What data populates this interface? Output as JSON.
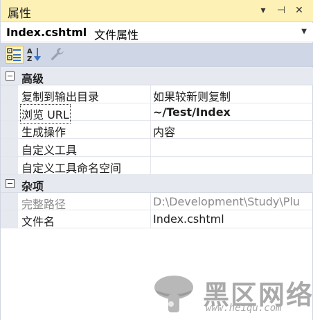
{
  "window": {
    "title": "属性",
    "dropdown_glyph": "▾",
    "pin_glyph": "⊣",
    "close_glyph": "✕"
  },
  "selector": {
    "object_name": "Index.cshtml",
    "object_type": "文件属性",
    "dropdown_glyph": "▼"
  },
  "toolbar": {
    "buttons": [
      {
        "icon": "categorized-icon",
        "active": true
      },
      {
        "icon": "alphabetical-sort-icon",
        "active": false
      },
      {
        "icon": "wrench-icon",
        "active": false
      }
    ]
  },
  "categories": [
    {
      "label": "高级",
      "properties": [
        {
          "name": "复制到输出目录",
          "value": "如果较新则复制"
        },
        {
          "name": "浏览 URL",
          "value": "~/Test/Index"
        },
        {
          "name": "生成操作",
          "value": "内容"
        },
        {
          "name": "自定义工具",
          "value": ""
        },
        {
          "name": "自定义工具命名空间",
          "value": ""
        }
      ]
    },
    {
      "label": "杂项",
      "properties": [
        {
          "name": "完整路径",
          "value": "D:\\Development\\Study\\Plu"
        },
        {
          "name": "文件名",
          "value": "Index.cshtml"
        }
      ]
    }
  ],
  "watermark": {
    "text": "黑区网络",
    "url": "www.heiqu.com"
  },
  "colors": {
    "title_bg": "#fdf1b6",
    "toolbar_bg": "#cfd6e5",
    "category_bg": "#e6e9ef",
    "readonly_text": "#8a8a8a"
  }
}
